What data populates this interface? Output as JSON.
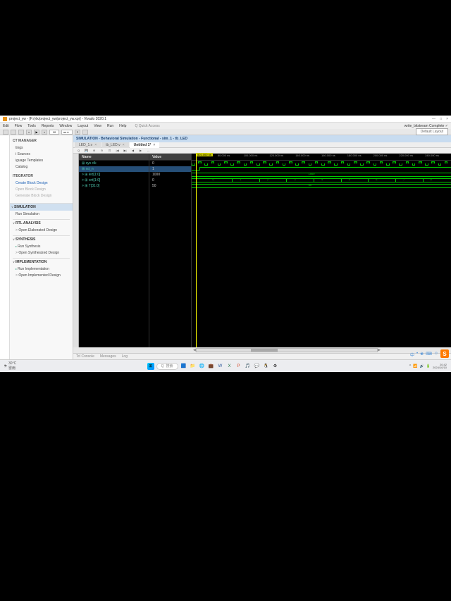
{
  "window": {
    "title": "project_yw - [F:/ylx/project_yw/project_yw.xpr] - Vivado 2020.1",
    "min": "—",
    "max": "□",
    "close": "×"
  },
  "menu": {
    "items": [
      "Edit",
      "Flow",
      "Tools",
      "Reports",
      "Window",
      "Layout",
      "View",
      "Run",
      "Help"
    ],
    "quick": "Q Quick Access",
    "status_right": "write_bitstream Complete ✓",
    "layout": "Default Layout"
  },
  "toolbar": {
    "time_val": "10",
    "time_unit": "us ▾"
  },
  "nav": {
    "manager": "CT MANAGER",
    "items_top": [
      "tings",
      "i Sources",
      "iguage Templates",
      "Catalog"
    ],
    "integrator": "ITEGRATOR",
    "int_items": [
      "Create Block Design",
      "Open Block Design",
      "Generate Block Design"
    ],
    "simulation": "SIMULATION",
    "sim_items": [
      "Run Simulation"
    ],
    "rtl": "RTL ANALYSIS",
    "rtl_items": [
      "Open Elaborated Design"
    ],
    "synth": "SYNTHESIS",
    "synth_items": [
      "Run Synthesis",
      "Open Synthesized Design"
    ],
    "impl": "IMPLEMENTATION",
    "impl_items": [
      "Run Implementation",
      "Open Implemented Design"
    ]
  },
  "sim": {
    "header": "SIMULATION - Behavioral Simulation - Functional - sim_1 - tb_LED",
    "tabs": [
      "LED_1.v",
      "tb_LED.v",
      "Untitled 1*"
    ],
    "close_x": "×"
  },
  "signals": {
    "name_header": "Name",
    "value_header": "Value",
    "rows": [
      {
        "name": "⊞ sys clk",
        "value": "0"
      },
      {
        "name": "⊞ rst_n",
        "value": "1"
      },
      {
        "name": "> ⊞ led[1:0]",
        "value": "1000"
      },
      {
        "name": "> ⊞ cnt[1:0]",
        "value": "0"
      },
      {
        "name": "> ⊞ T[31:0]",
        "value": "50"
      }
    ]
  },
  "waveform": {
    "marker": "501.000 ns",
    "ticks": [
      "80.000 ns",
      "100.000 ns",
      "120.000 ns",
      "140.000 ns",
      "160.000 ns",
      "180.000 ns",
      "200.000 ns",
      "220.000 ns",
      "240.000 ns",
      "260.000 ns"
    ],
    "bus_led": "1000",
    "bus_cnt": [
      "0",
      "1",
      "2",
      "3",
      "4",
      "5",
      "6",
      "7",
      "8"
    ],
    "bus_t": "50"
  },
  "bottom_tabs": [
    "Tcl Console",
    "Messages",
    "Log"
  ],
  "taskbar": {
    "weather_temp": "30°C",
    "weather_desc": "雷雨",
    "search": "搜索",
    "time": "20:42",
    "date": "2024/10/10",
    "sogou": "S"
  },
  "ime": [
    "中",
    "•",
    "❀",
    "⌨",
    "☺"
  ]
}
